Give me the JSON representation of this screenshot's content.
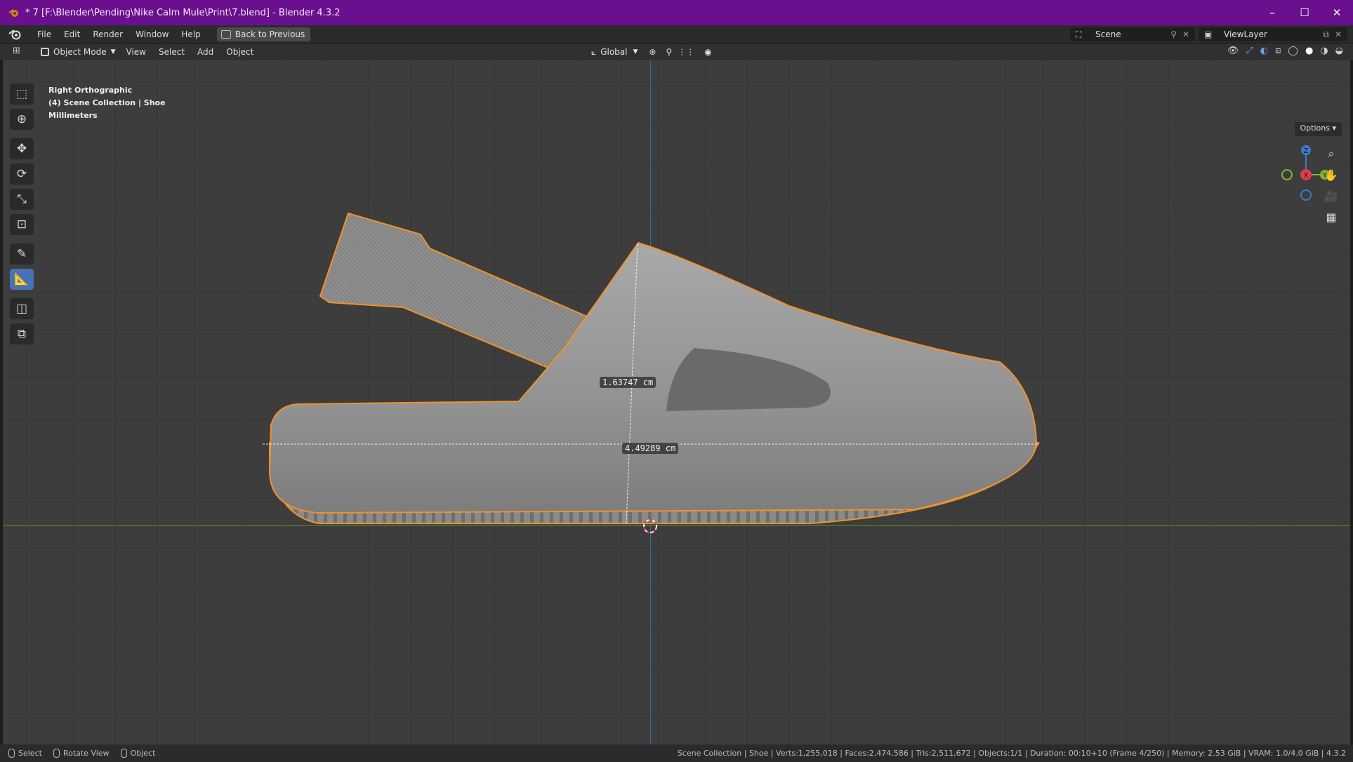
{
  "window": {
    "title": "* 7 [F:\\Blender\\Pending\\Nike Calm Mule\\Print\\7.blend] - Blender 4.3.2",
    "controls": [
      "–",
      "☐",
      "✕"
    ]
  },
  "menubar": {
    "items": [
      "File",
      "Edit",
      "Render",
      "Window",
      "Help"
    ],
    "back_button": "Back to Previous",
    "scene": "Scene",
    "view_layer": "ViewLayer"
  },
  "viewport_header": {
    "mode": "Object Mode",
    "menus": [
      "View",
      "Select",
      "Add",
      "Object"
    ],
    "orientation": "Global",
    "options": "Options"
  },
  "viewport": {
    "view_name": "Right Orthographic",
    "collection": "(4) Scene Collection | Shoe",
    "units": "Millimeters",
    "measure_1": "1.63747 cm",
    "measure_2": "4.49289 cm",
    "gizmo": {
      "z": "Z",
      "x": "X",
      "y": "Y"
    }
  },
  "toolbar": {
    "tools": [
      "select-box-icon",
      "cursor-icon",
      "move-icon",
      "rotate-icon",
      "scale-icon",
      "transform-icon",
      "annotate-icon",
      "measure-icon",
      "add-cube-icon",
      "add-object-icon"
    ],
    "active": "measure-icon"
  },
  "statusbar": {
    "select": "Select",
    "rotate_view": "Rotate View",
    "object": "Object",
    "info": "Scene Collection | Shoe | Verts:1,255,018 | Faces:2,474,586 | Tris:2,511,672 | Objects:1/1 | Duration: 00:10+10 (Frame 4/250) | Memory: 2.53 GiB | VRAM: 1.0/4.0 GiB | 4.3.2"
  },
  "colors": {
    "titlebar": "#6a0f8e",
    "selection_outline": "#f0922a",
    "active_tool": "#4772b3"
  }
}
